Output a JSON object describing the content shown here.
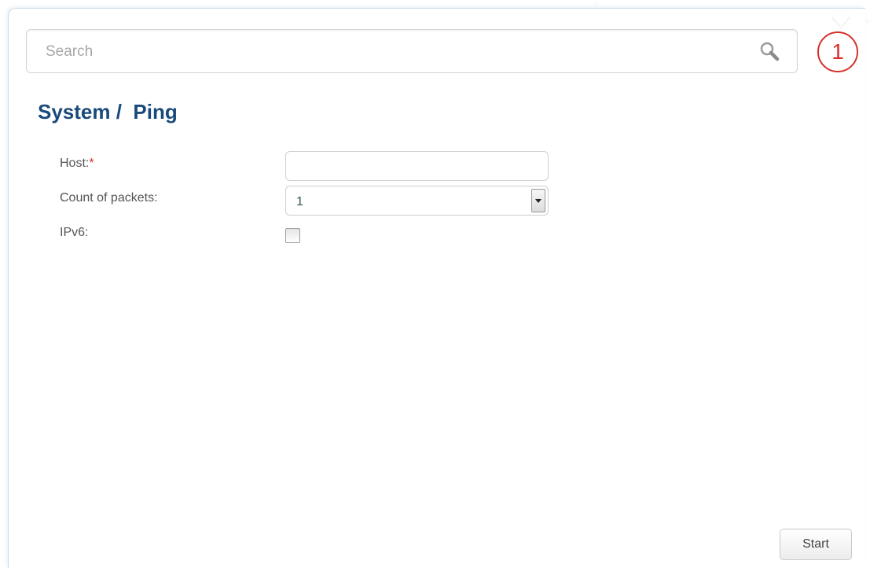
{
  "search": {
    "placeholder": "Search"
  },
  "notifications": {
    "count": "1"
  },
  "page": {
    "title": "System /  Ping"
  },
  "form": {
    "host": {
      "label": "Host:",
      "required_mark": "*",
      "value": ""
    },
    "count_of_packets": {
      "label": "Count of packets:",
      "selected": "1"
    },
    "ipv6": {
      "label": "IPv6:",
      "checked": false
    }
  },
  "actions": {
    "start_label": "Start"
  },
  "colors": {
    "title": "#1a4a7a",
    "required": "#d7302c",
    "counter": "#d7302c"
  }
}
